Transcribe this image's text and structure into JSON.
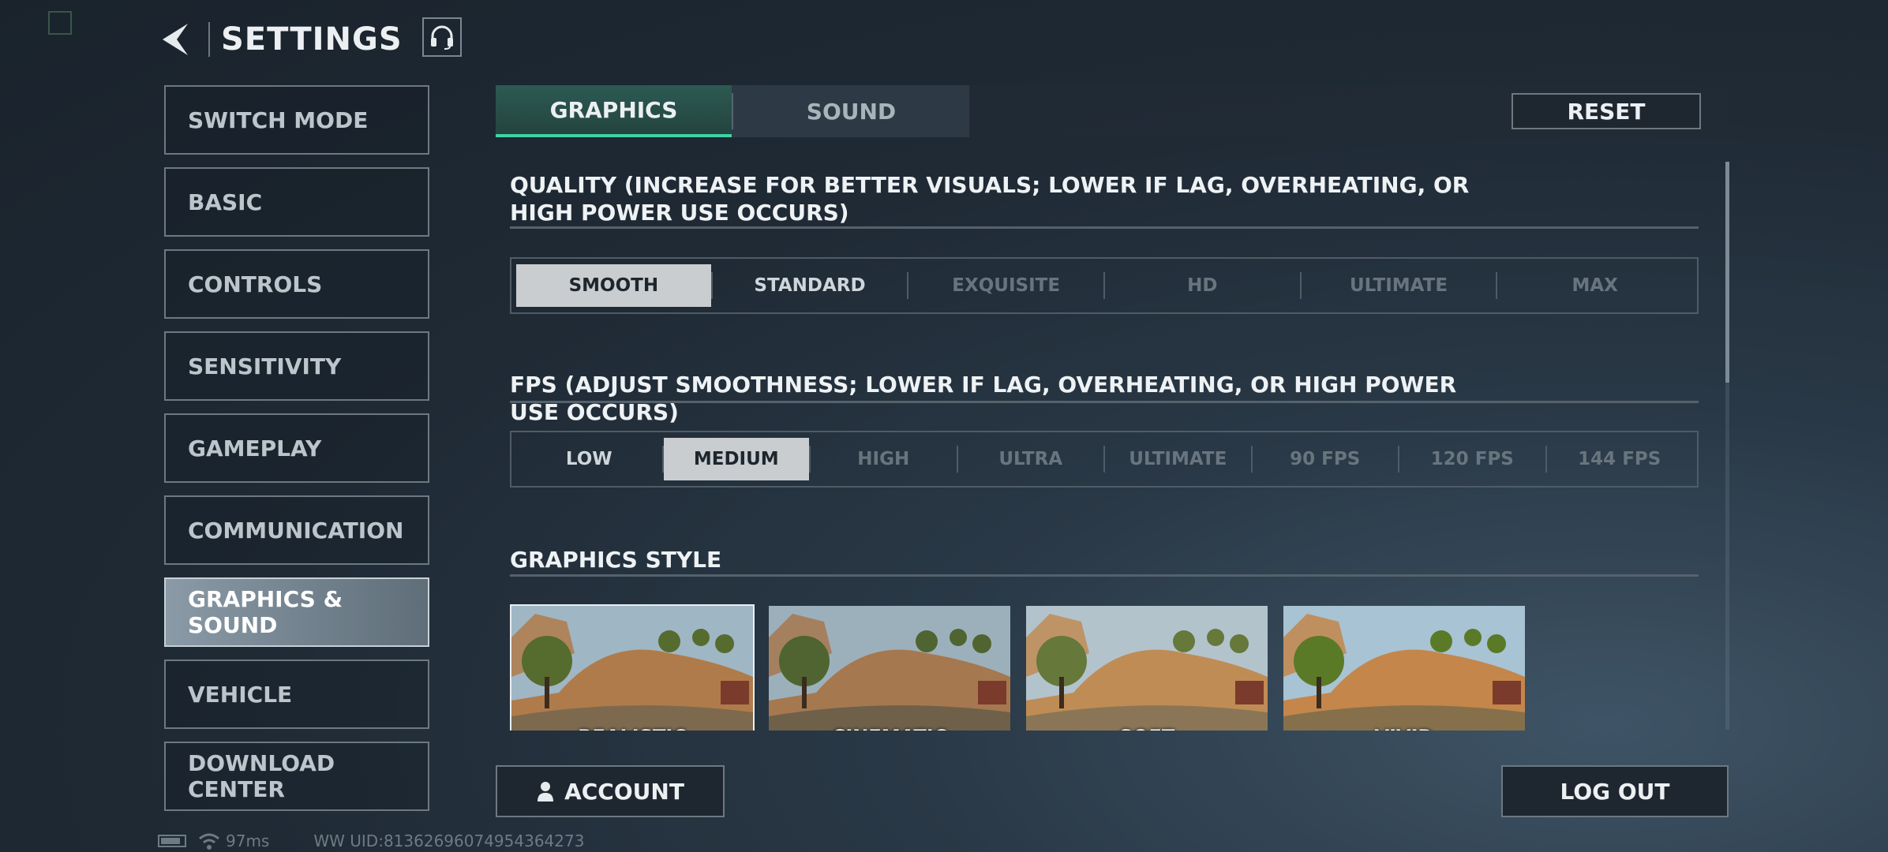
{
  "header": {
    "title": "SETTINGS",
    "back_icon": "back-arrow-icon",
    "support_icon": "headset-icon"
  },
  "sidebar": {
    "items": [
      {
        "label": "SWITCH MODE",
        "active": false
      },
      {
        "label": "BASIC",
        "active": false
      },
      {
        "label": "CONTROLS",
        "active": false
      },
      {
        "label": "SENSITIVITY",
        "active": false
      },
      {
        "label": "GAMEPLAY",
        "active": false
      },
      {
        "label": "COMMUNICATION",
        "active": false
      },
      {
        "label": "GRAPHICS & SOUND",
        "active": true
      },
      {
        "label": "VEHICLE",
        "active": false
      },
      {
        "label": "DOWNLOAD CENTER",
        "active": false
      }
    ]
  },
  "tabs": {
    "graphics": "GRAPHICS",
    "sound": "SOUND",
    "active": "GRAPHICS"
  },
  "reset_label": "RESET",
  "quality": {
    "title": "QUALITY (INCREASE FOR BETTER VISUALS; LOWER IF LAG, OVERHEATING, OR HIGH POWER USE OCCURS)",
    "options": [
      "SMOOTH",
      "STANDARD",
      "EXQUISITE",
      "HD",
      "ULTIMATE",
      "MAX"
    ],
    "selected": "SMOOTH"
  },
  "fps": {
    "title": "FPS (ADJUST SMOOTHNESS; LOWER IF LAG, OVERHEATING, OR HIGH POWER USE OCCURS)",
    "options": [
      "LOW",
      "MEDIUM",
      "HIGH",
      "ULTRA",
      "ULTIMATE",
      "90 FPS",
      "120 FPS",
      "144 FPS"
    ],
    "selected": "MEDIUM"
  },
  "graphics_style": {
    "title": "GRAPHICS STYLE",
    "options": [
      "REALISTIC",
      "CINEMATIC",
      "SOFT",
      "VIVID"
    ],
    "selected": "REALISTIC"
  },
  "footer": {
    "account_label": "ACCOUNT",
    "logout_label": "LOG OUT"
  },
  "status": {
    "ping": "97ms",
    "uid": "WW UID:8136269607495436427​3"
  },
  "colors": {
    "accent": "#3fd3a4",
    "selected_option": "#c9cdd0",
    "panel_border": "#6d7880"
  }
}
